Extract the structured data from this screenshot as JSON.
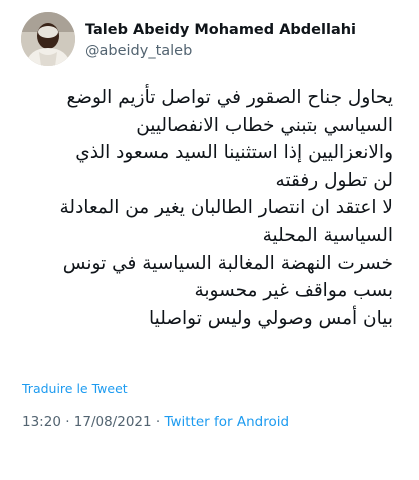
{
  "author": {
    "display_name": "Taleb Abeidy Mohamed Abdellahi",
    "handle": "@abeidy_taleb"
  },
  "tweet": {
    "lines": [
      "يحاول جناح الصقور في تواصل تأزيم الوضع",
      "السياسي بتبني خطاب الانفصاليين",
      "والانعزاليين إذا استثنينا السيد مسعود الذي",
      "لن تطول رفقته",
      "لا اعتقد ان انتصار الطالبان يغير من المعادلة",
      "السياسية المحلية",
      "خسرت النهضة المغالبة السياسية في تونس",
      "بسب مواقف غير محسوبة",
      "بيان أمس وصولي وليس تواصليا"
    ]
  },
  "actions": {
    "translate_label": "Traduire le Tweet"
  },
  "meta": {
    "time": "13:20",
    "separator": " · ",
    "date": "17/08/2021",
    "source": "Twitter for Android"
  },
  "colors": {
    "link": "#1d9bf0",
    "secondary_text": "#536471",
    "primary_text": "#0f1419"
  }
}
